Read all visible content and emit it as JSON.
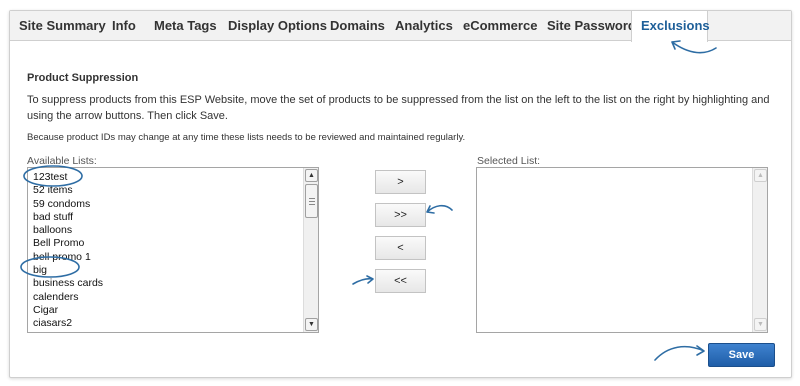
{
  "tabs": [
    {
      "label": "Site Summary",
      "active": false
    },
    {
      "label": "Info",
      "active": false
    },
    {
      "label": "Meta Tags",
      "active": false
    },
    {
      "label": "Display Options",
      "active": false
    },
    {
      "label": "Domains",
      "active": false
    },
    {
      "label": "Analytics",
      "active": false
    },
    {
      "label": "eCommerce",
      "active": false
    },
    {
      "label": "Site Password",
      "active": false
    },
    {
      "label": "Exclusions",
      "active": true
    }
  ],
  "section": {
    "title": "Product Suppression",
    "description": "To suppress products from this ESP Website, move the set of products to be suppressed from the list on the left to the list on the right by highlighting and using the arrow buttons. Then click Save.",
    "note": "Because product IDs may change at any time these lists needs to be reviewed and maintained regularly."
  },
  "available": {
    "label": "Available Lists:",
    "items": [
      "123test",
      "52 items",
      "59 condoms",
      "bad stuff",
      "balloons",
      "Bell Promo",
      "bell promo 1",
      "big",
      "business cards",
      "calenders",
      "Cigar",
      "ciasars2"
    ]
  },
  "selected": {
    "label": "Selected List:",
    "items": []
  },
  "arrows": {
    "move_right": ">",
    "move_all_right": ">>",
    "move_left": "<",
    "move_all_left": "<<"
  },
  "save_label": "Save",
  "colors": {
    "accent": "#1e5f99",
    "annotation": "#2e6da4",
    "save_button": "#2a6bb8"
  }
}
